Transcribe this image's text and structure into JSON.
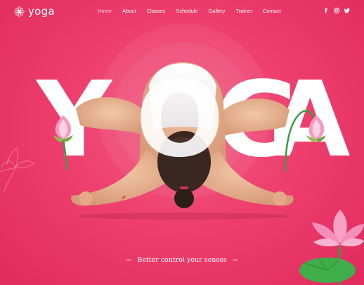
{
  "brand": {
    "name": "yoga",
    "logo_icon": "mandala-icon"
  },
  "nav": {
    "items": [
      {
        "label": "Home",
        "active": true
      },
      {
        "label": "About",
        "active": false
      },
      {
        "label": "Classes",
        "active": false
      },
      {
        "label": "Schedule",
        "active": false
      },
      {
        "label": "Gallery",
        "active": false
      },
      {
        "label": "Trainer",
        "active": false
      },
      {
        "label": "Contact",
        "active": false
      }
    ]
  },
  "social": [
    "facebook-icon",
    "instagram-icon",
    "twitter-icon"
  ],
  "hero": {
    "headline_letters": [
      "Y",
      "O",
      "G",
      "A"
    ],
    "tagline": "Better control your senses"
  },
  "colors": {
    "background": "#ee3f6e",
    "background_dark": "#e02b5c",
    "text": "#ffffff",
    "lotus_pink": "#f7a1c6",
    "leaf_green": "#3fae4a"
  }
}
